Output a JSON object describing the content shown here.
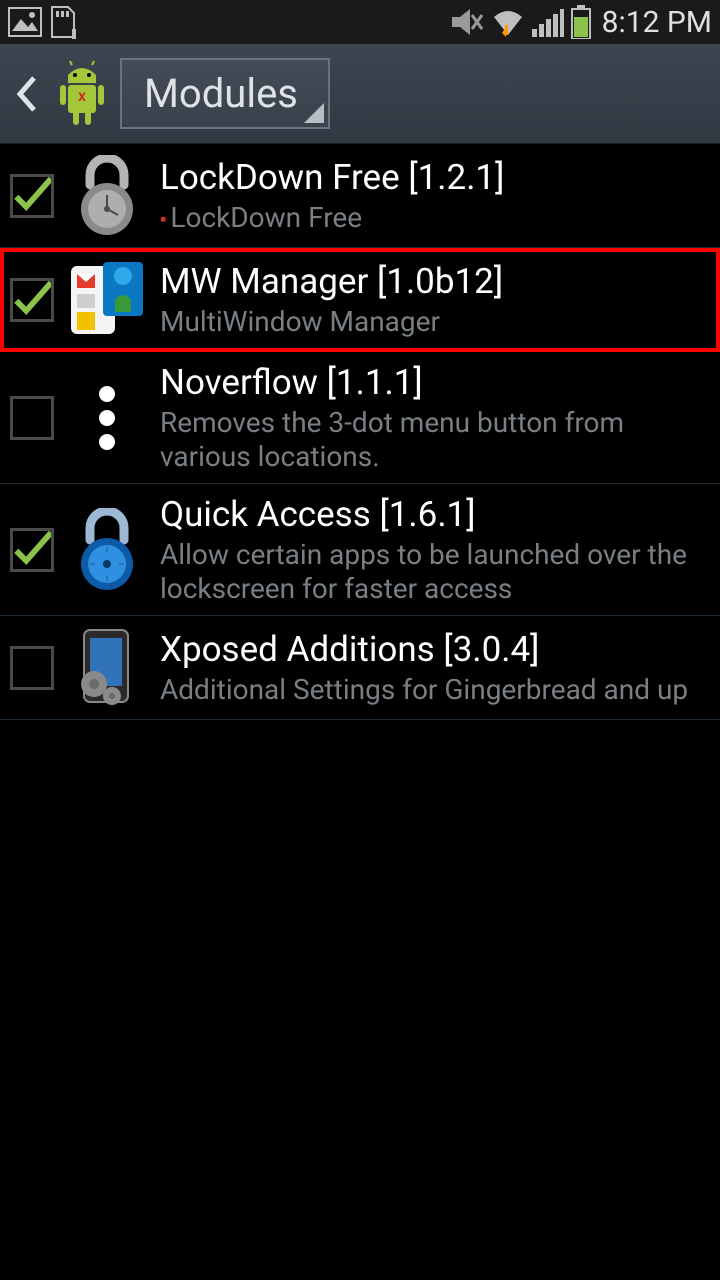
{
  "status_bar": {
    "time": "8:12 PM"
  },
  "header": {
    "title": "Modules"
  },
  "modules": [
    {
      "checked": true,
      "highlighted": false,
      "icon": "lock-gray",
      "title": "LockDown Free [1.2.1]",
      "desc": "LockDown Free",
      "desc_red_tick": true
    },
    {
      "checked": true,
      "highlighted": true,
      "icon": "mw-manager",
      "title": "MW Manager [1.0b12]",
      "desc": "MultiWindow Manager",
      "desc_red_tick": false
    },
    {
      "checked": false,
      "highlighted": false,
      "icon": "three-dots",
      "title": "Noverflow [1.1.1]",
      "desc": "Removes the 3-dot menu button from various locations.",
      "desc_red_tick": false
    },
    {
      "checked": true,
      "highlighted": false,
      "icon": "lock-blue",
      "title": "Quick Access [1.6.1]",
      "desc": "Allow certain apps to be launched over the lockscreen for faster access",
      "desc_red_tick": false
    },
    {
      "checked": false,
      "highlighted": false,
      "icon": "xposed-additions",
      "title": "Xposed Additions [3.0.4]",
      "desc": "Additional Settings for Gingerbread and up",
      "desc_red_tick": false
    }
  ]
}
